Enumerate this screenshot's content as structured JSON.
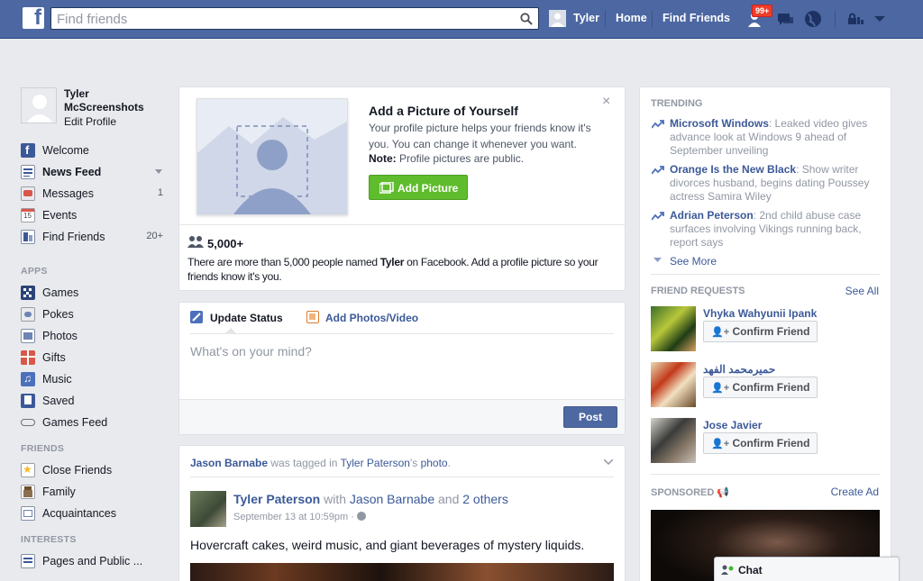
{
  "topbar": {
    "search_placeholder": "Find friends",
    "user_name": "Tyler",
    "home": "Home",
    "find_friends": "Find Friends",
    "notif_count": "99+"
  },
  "left_nav": {
    "name": "Tyler McScreenshots",
    "edit_profile": "Edit Profile",
    "items": [
      {
        "label": "Welcome",
        "icon": "facebook-icon",
        "count": ""
      },
      {
        "label": "News Feed",
        "icon": "news-feed-icon",
        "count": ""
      },
      {
        "label": "Messages",
        "icon": "messages-icon",
        "count": "1"
      },
      {
        "label": "Events",
        "icon": "calendar-icon",
        "count": ""
      },
      {
        "label": "Find Friends",
        "icon": "friends-icon",
        "count": "20+"
      }
    ],
    "apps_header": "APPS",
    "apps": [
      {
        "label": "Games",
        "icon": "games-icon"
      },
      {
        "label": "Pokes",
        "icon": "pokes-icon"
      },
      {
        "label": "Photos",
        "icon": "photos-icon"
      },
      {
        "label": "Gifts",
        "icon": "gift-icon"
      },
      {
        "label": "Music",
        "icon": "music-icon"
      },
      {
        "label": "Saved",
        "icon": "saved-icon"
      },
      {
        "label": "Games Feed",
        "icon": "controller-icon"
      }
    ],
    "friends_header": "FRIENDS",
    "friends": [
      {
        "label": "Close Friends",
        "icon": "star-icon"
      },
      {
        "label": "Family",
        "icon": "family-icon"
      },
      {
        "label": "Acquaintances",
        "icon": "acquaintances-icon"
      }
    ],
    "interests_header": "INTERESTS",
    "interests": [
      {
        "label": "Pages and Public ...",
        "icon": "pages-icon"
      }
    ]
  },
  "add_picture": {
    "title": "Add a Picture of Yourself",
    "desc": "Your profile picture helps your friends know it's you. You can change it whenever you want.",
    "note_label": "Note:",
    "note_text": " Profile pictures are public.",
    "button": "Add Picture",
    "count": "5,000+",
    "footer_1": "There are more than 5,000 people named ",
    "footer_name": "Tyler",
    "footer_2": " on Facebook. Add a profile picture so your friends know it's you."
  },
  "composer": {
    "tab_status": "Update Status",
    "tab_photos": "Add Photos/Video",
    "placeholder": "What's on your mind?",
    "post": "Post"
  },
  "story": {
    "tagged_actor": "Jason Barnabe",
    "tagged_text": " was tagged in ",
    "tagged_owner": "Tyler Paterson",
    "tagged_possessive": "'s ",
    "tagged_object": "photo",
    "tagged_period": ".",
    "author": "Tyler Paterson",
    "with": " with ",
    "with_person": "Jason Barnabe",
    "and": " and ",
    "others": "2 others",
    "time": "September 13 at 10:59pm · ",
    "text": "Hovercraft cakes, weird music, and giant beverages of mystery liquids."
  },
  "trending": {
    "header": "TRENDING",
    "items": [
      {
        "topic": "Microsoft Windows",
        "desc": ": Leaked video gives advance look at Windows 9 ahead of September unveiling"
      },
      {
        "topic": "Orange Is the New Black",
        "desc": ": Show writer divorces husband, begins dating Poussey actress Samira Wiley"
      },
      {
        "topic": "Adrian Peterson",
        "desc": ": 2nd child abuse case surfaces involving Vikings running back, report says"
      }
    ],
    "see_more": "See More"
  },
  "friend_requests": {
    "header": "FRIEND REQUESTS",
    "see_all": "See All",
    "confirm": "Confirm Friend",
    "people": [
      {
        "name": "Vhyka Wahyunii Ipank"
      },
      {
        "name": "حميرمحمد الفهد"
      },
      {
        "name": "Jose Javier"
      }
    ]
  },
  "sponsored": {
    "header": "SPONSORED",
    "create_ad": "Create Ad"
  },
  "chat": {
    "label": "Chat"
  },
  "colors": {
    "brand": "#4c67a1",
    "link": "#3b5998",
    "green_button": "#5fbc2c",
    "badge": "#f03d25"
  }
}
